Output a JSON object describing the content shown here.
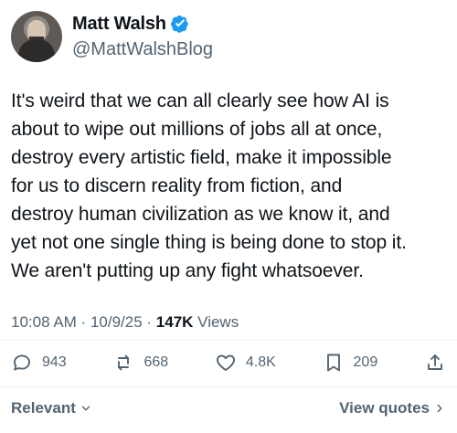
{
  "header": {
    "display_name": "Matt Walsh",
    "handle": "@MattWalshBlog",
    "verified_icon": "verified-badge-icon",
    "avatar_icon": "avatar"
  },
  "tweet": {
    "text": "It's weird that we can all clearly see how AI is\nabout to wipe out millions of jobs all at once,\ndestroy every artistic field, make it impossible\nfor us to discern reality from fiction, and\ndestroy human civilization as we know it, and\nyet not one single thing is being done to stop it.\nWe aren't putting up any fight whatsoever."
  },
  "meta": {
    "time": "10:08 AM",
    "date": "10/9/25",
    "views_count": "147K",
    "views_label": "Views",
    "separator_1": " · ",
    "separator_2": " · "
  },
  "actions": {
    "reply_count": "943",
    "repost_count": "668",
    "like_count": "4.8K",
    "bookmark_count": "209",
    "reply_icon": "reply-icon",
    "repost_icon": "repost-icon",
    "like_icon": "heart-icon",
    "bookmark_icon": "bookmark-icon",
    "share_icon": "share-icon"
  },
  "footer": {
    "left_label": "Relevant",
    "right_label": "View quotes"
  },
  "colors": {
    "text": "#0f1419",
    "muted": "#536471",
    "verified": "#1d9bf0",
    "border": "#eff3f4"
  }
}
